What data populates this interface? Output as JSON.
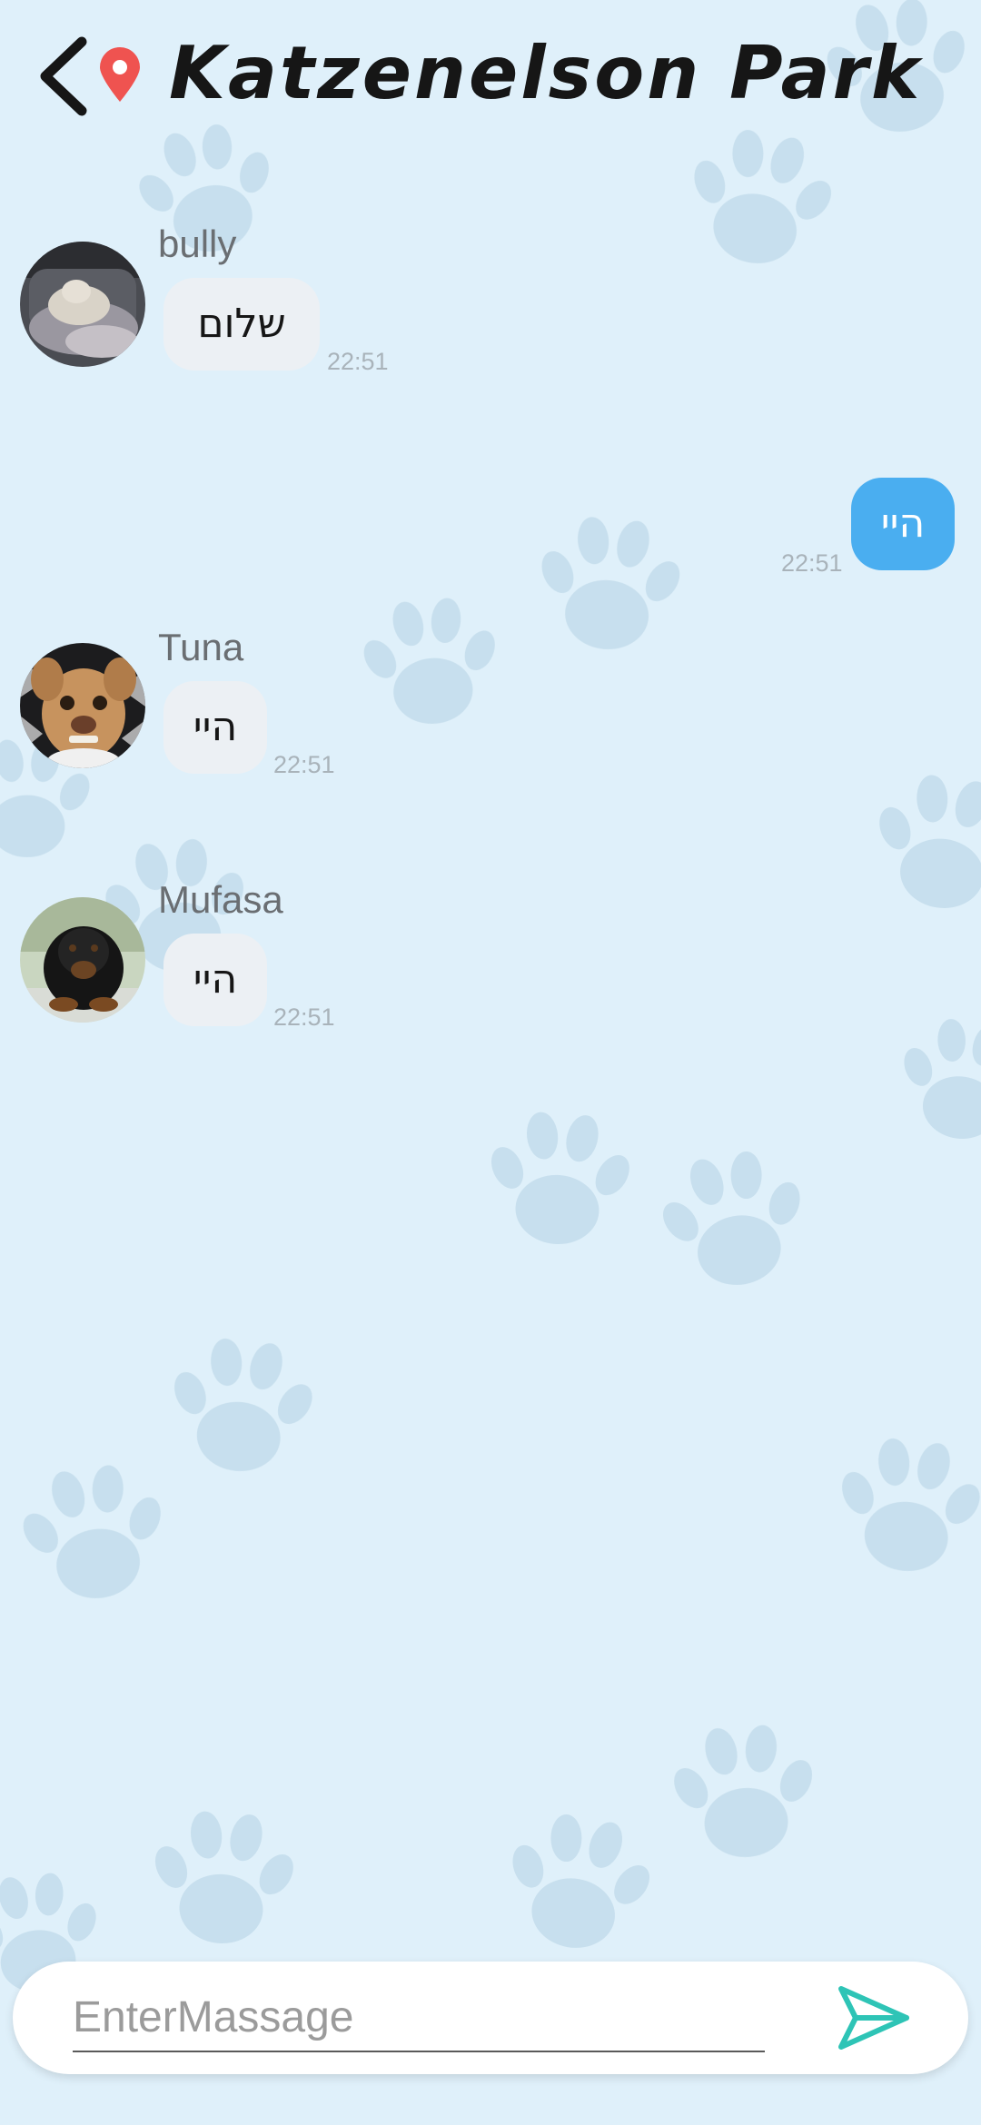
{
  "header": {
    "title": "Katzenelson Park",
    "back_icon": "chevron-left-icon",
    "location_icon": "map-pin-icon",
    "pin_color": "#ef5350"
  },
  "messages": [
    {
      "sender": "bully",
      "text": "שלום",
      "time": "22:51",
      "own": false,
      "avatar": "cat-on-couch"
    },
    {
      "sender": "",
      "text": "היי",
      "time": "22:51",
      "own": true
    },
    {
      "sender": "Tuna",
      "text": "היי",
      "time": "22:51",
      "own": false,
      "avatar": "small-tan-dog"
    },
    {
      "sender": "Mufasa",
      "text": "היי",
      "time": "22:51",
      "own": false,
      "avatar": "black-fluffy-dog"
    }
  ],
  "composer": {
    "placeholder": "EnterMassage",
    "value": "",
    "send_icon": "send-icon"
  },
  "colors": {
    "background": "#dff0fa",
    "paw": "#c3dceb",
    "own_bubble": "#4aaef0",
    "other_bubble": "#ecf0f4",
    "send_icon": "#2ec4b6",
    "time_text": "#a9b3ba"
  }
}
